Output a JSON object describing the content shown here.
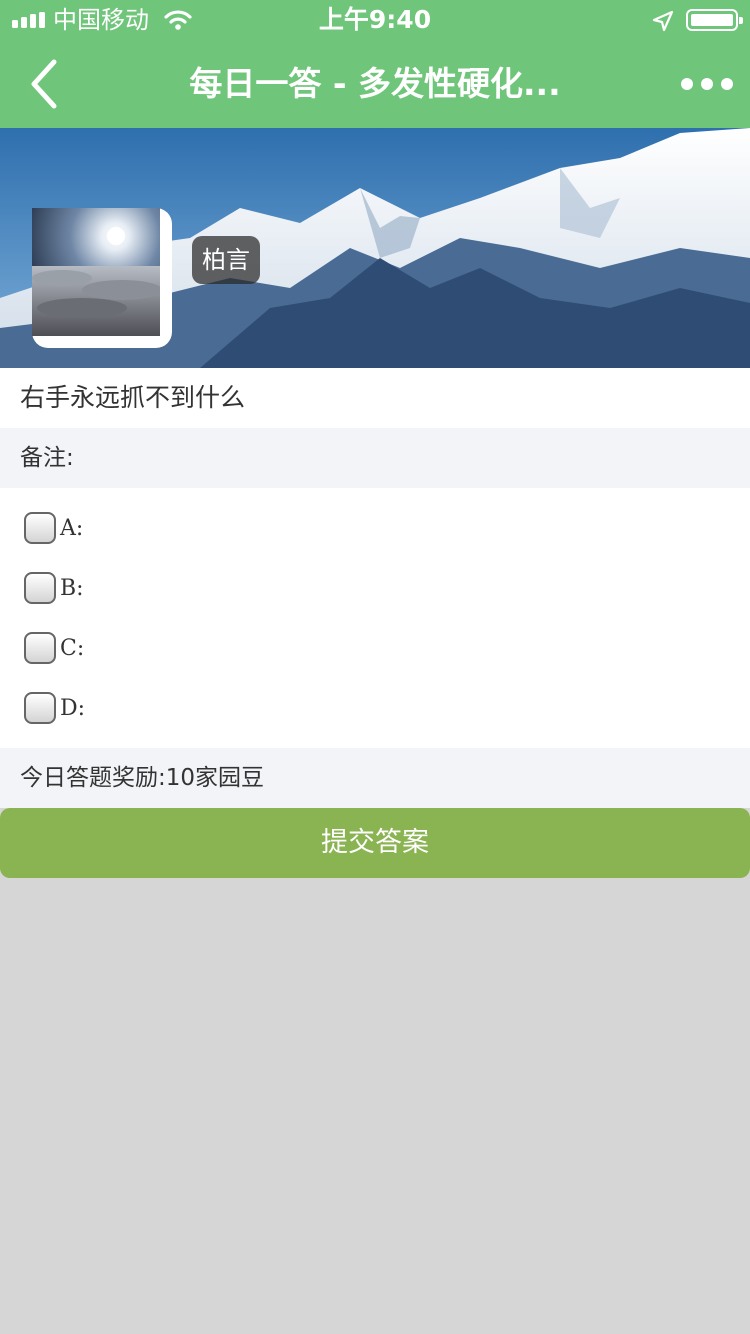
{
  "status_bar": {
    "carrier": "中国移动",
    "time": "上午9:40",
    "icons": [
      "signal-icon",
      "wifi-icon",
      "location-icon",
      "battery-icon"
    ]
  },
  "nav": {
    "title": "每日一答 - 多发性硬化...",
    "back_icon": "chevron-left-icon",
    "more_icon": "more-dots-icon"
  },
  "banner": {
    "username": "柏言"
  },
  "question": {
    "text": "右手永远抓不到什么",
    "note_label": "备注:"
  },
  "options": [
    {
      "label": "A:"
    },
    {
      "label": "B:"
    },
    {
      "label": "C:"
    },
    {
      "label": "D:"
    }
  ],
  "reward": {
    "text": "今日答题奖励:10家园豆"
  },
  "submit": {
    "label": "提交答案"
  },
  "colors": {
    "header_green": "#6fc57a",
    "submit_green": "#8ab352",
    "page_gray": "#d6d6d6",
    "row_gray": "#f3f4f8"
  }
}
